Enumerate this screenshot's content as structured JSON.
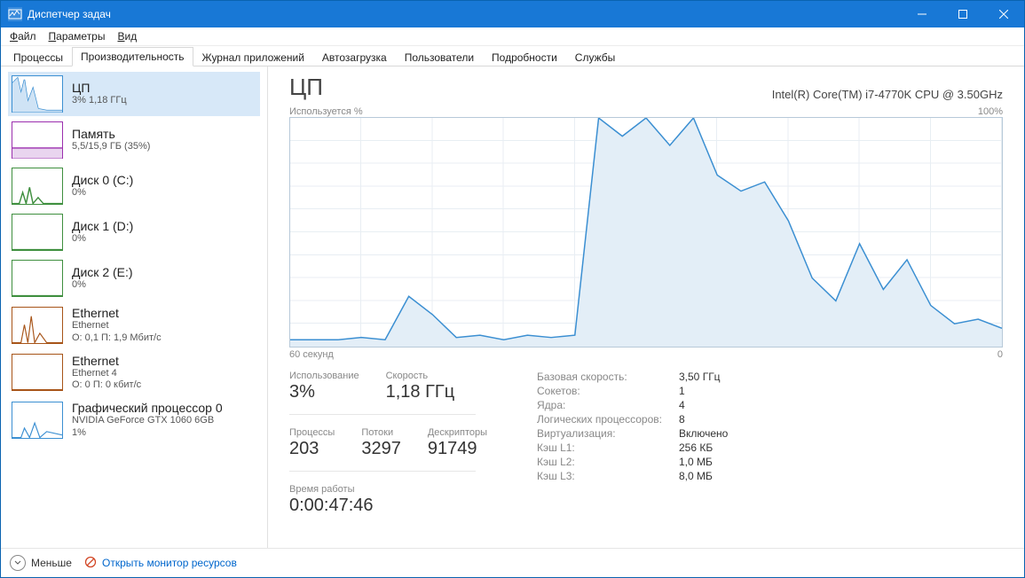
{
  "window": {
    "title": "Диспетчер задач"
  },
  "menu": {
    "file": "Файл",
    "options": "Параметры",
    "view": "Вид"
  },
  "tabs": {
    "processes": "Процессы",
    "performance": "Производительность",
    "app_history": "Журнал приложений",
    "startup": "Автозагрузка",
    "users": "Пользователи",
    "details": "Подробности",
    "services": "Службы"
  },
  "sidebar": {
    "cpu": {
      "title": "ЦП",
      "sub": "3%  1,18 ГГц",
      "color": "#3b8fd2"
    },
    "mem": {
      "title": "Память",
      "sub": "5,5/15,9 ГБ (35%)",
      "color": "#9b2fae"
    },
    "disk0": {
      "title": "Диск 0 (C:)",
      "sub": "0%",
      "color": "#3f8f3f"
    },
    "disk1": {
      "title": "Диск 1 (D:)",
      "sub": "0%",
      "color": "#3f8f3f"
    },
    "disk2": {
      "title": "Диск 2 (E:)",
      "sub": "0%",
      "color": "#3f8f3f"
    },
    "eth0": {
      "title": "Ethernet",
      "sub1": "Ethernet",
      "sub2": "О: 0,1 П: 1,9 Мбит/с",
      "color": "#a75418"
    },
    "eth1": {
      "title": "Ethernet",
      "sub1": "Ethernet 4",
      "sub2": "О: 0 П: 0 кбит/с",
      "color": "#a75418"
    },
    "gpu": {
      "title": "Графический процессор 0",
      "sub1": "NVIDIA GeForce GTX 1060 6GB",
      "sub2": "1%",
      "color": "#3b8fd2"
    }
  },
  "main": {
    "title": "ЦП",
    "subtitle": "Intel(R) Core(TM) i7-4770K CPU @ 3.50GHz",
    "chart_top_left": "Используется %",
    "chart_top_right": "100%",
    "chart_bottom_left": "60 секунд",
    "chart_bottom_right": "0"
  },
  "stats": {
    "util_label": "Использование",
    "util_value": "3%",
    "speed_label": "Скорость",
    "speed_value": "1,18 ГГц",
    "proc_label": "Процессы",
    "proc_value": "203",
    "thr_label": "Потоки",
    "thr_value": "3297",
    "hnd_label": "Дескрипторы",
    "hnd_value": "91749",
    "uptime_label": "Время работы",
    "uptime_value": "0:00:47:46"
  },
  "details": {
    "base_speed_k": "Базовая скорость:",
    "base_speed_v": "3,50 ГГц",
    "sockets_k": "Сокетов:",
    "sockets_v": "1",
    "cores_k": "Ядра:",
    "cores_v": "4",
    "lproc_k": "Логических процессоров:",
    "lproc_v": "8",
    "virt_k": "Виртуализация:",
    "virt_v": "Включено",
    "l1_k": "Кэш L1:",
    "l1_v": "256 КБ",
    "l2_k": "Кэш L2:",
    "l2_v": "1,0 МБ",
    "l3_k": "Кэш L3:",
    "l3_v": "8,0 МБ"
  },
  "footer": {
    "fewer": "Меньше",
    "open_resmon": "Открыть монитор ресурсов"
  },
  "chart_data": {
    "type": "area",
    "title": "ЦП — Используется %",
    "xlabel": "секунд назад",
    "ylabel": "Используется %",
    "ylim": [
      0,
      100
    ],
    "xlim_seconds": [
      60,
      0
    ],
    "x": [
      60,
      58,
      56,
      54,
      52,
      50,
      48,
      46,
      44,
      42,
      40,
      38,
      36,
      34,
      32,
      30,
      28,
      26,
      24,
      22,
      20,
      18,
      16,
      14,
      12,
      10,
      8,
      6,
      4,
      2,
      0
    ],
    "values": [
      3,
      3,
      3,
      4,
      3,
      22,
      14,
      4,
      5,
      3,
      5,
      4,
      5,
      100,
      92,
      100,
      88,
      100,
      75,
      68,
      72,
      55,
      30,
      20,
      45,
      25,
      38,
      18,
      10,
      12,
      8
    ]
  }
}
